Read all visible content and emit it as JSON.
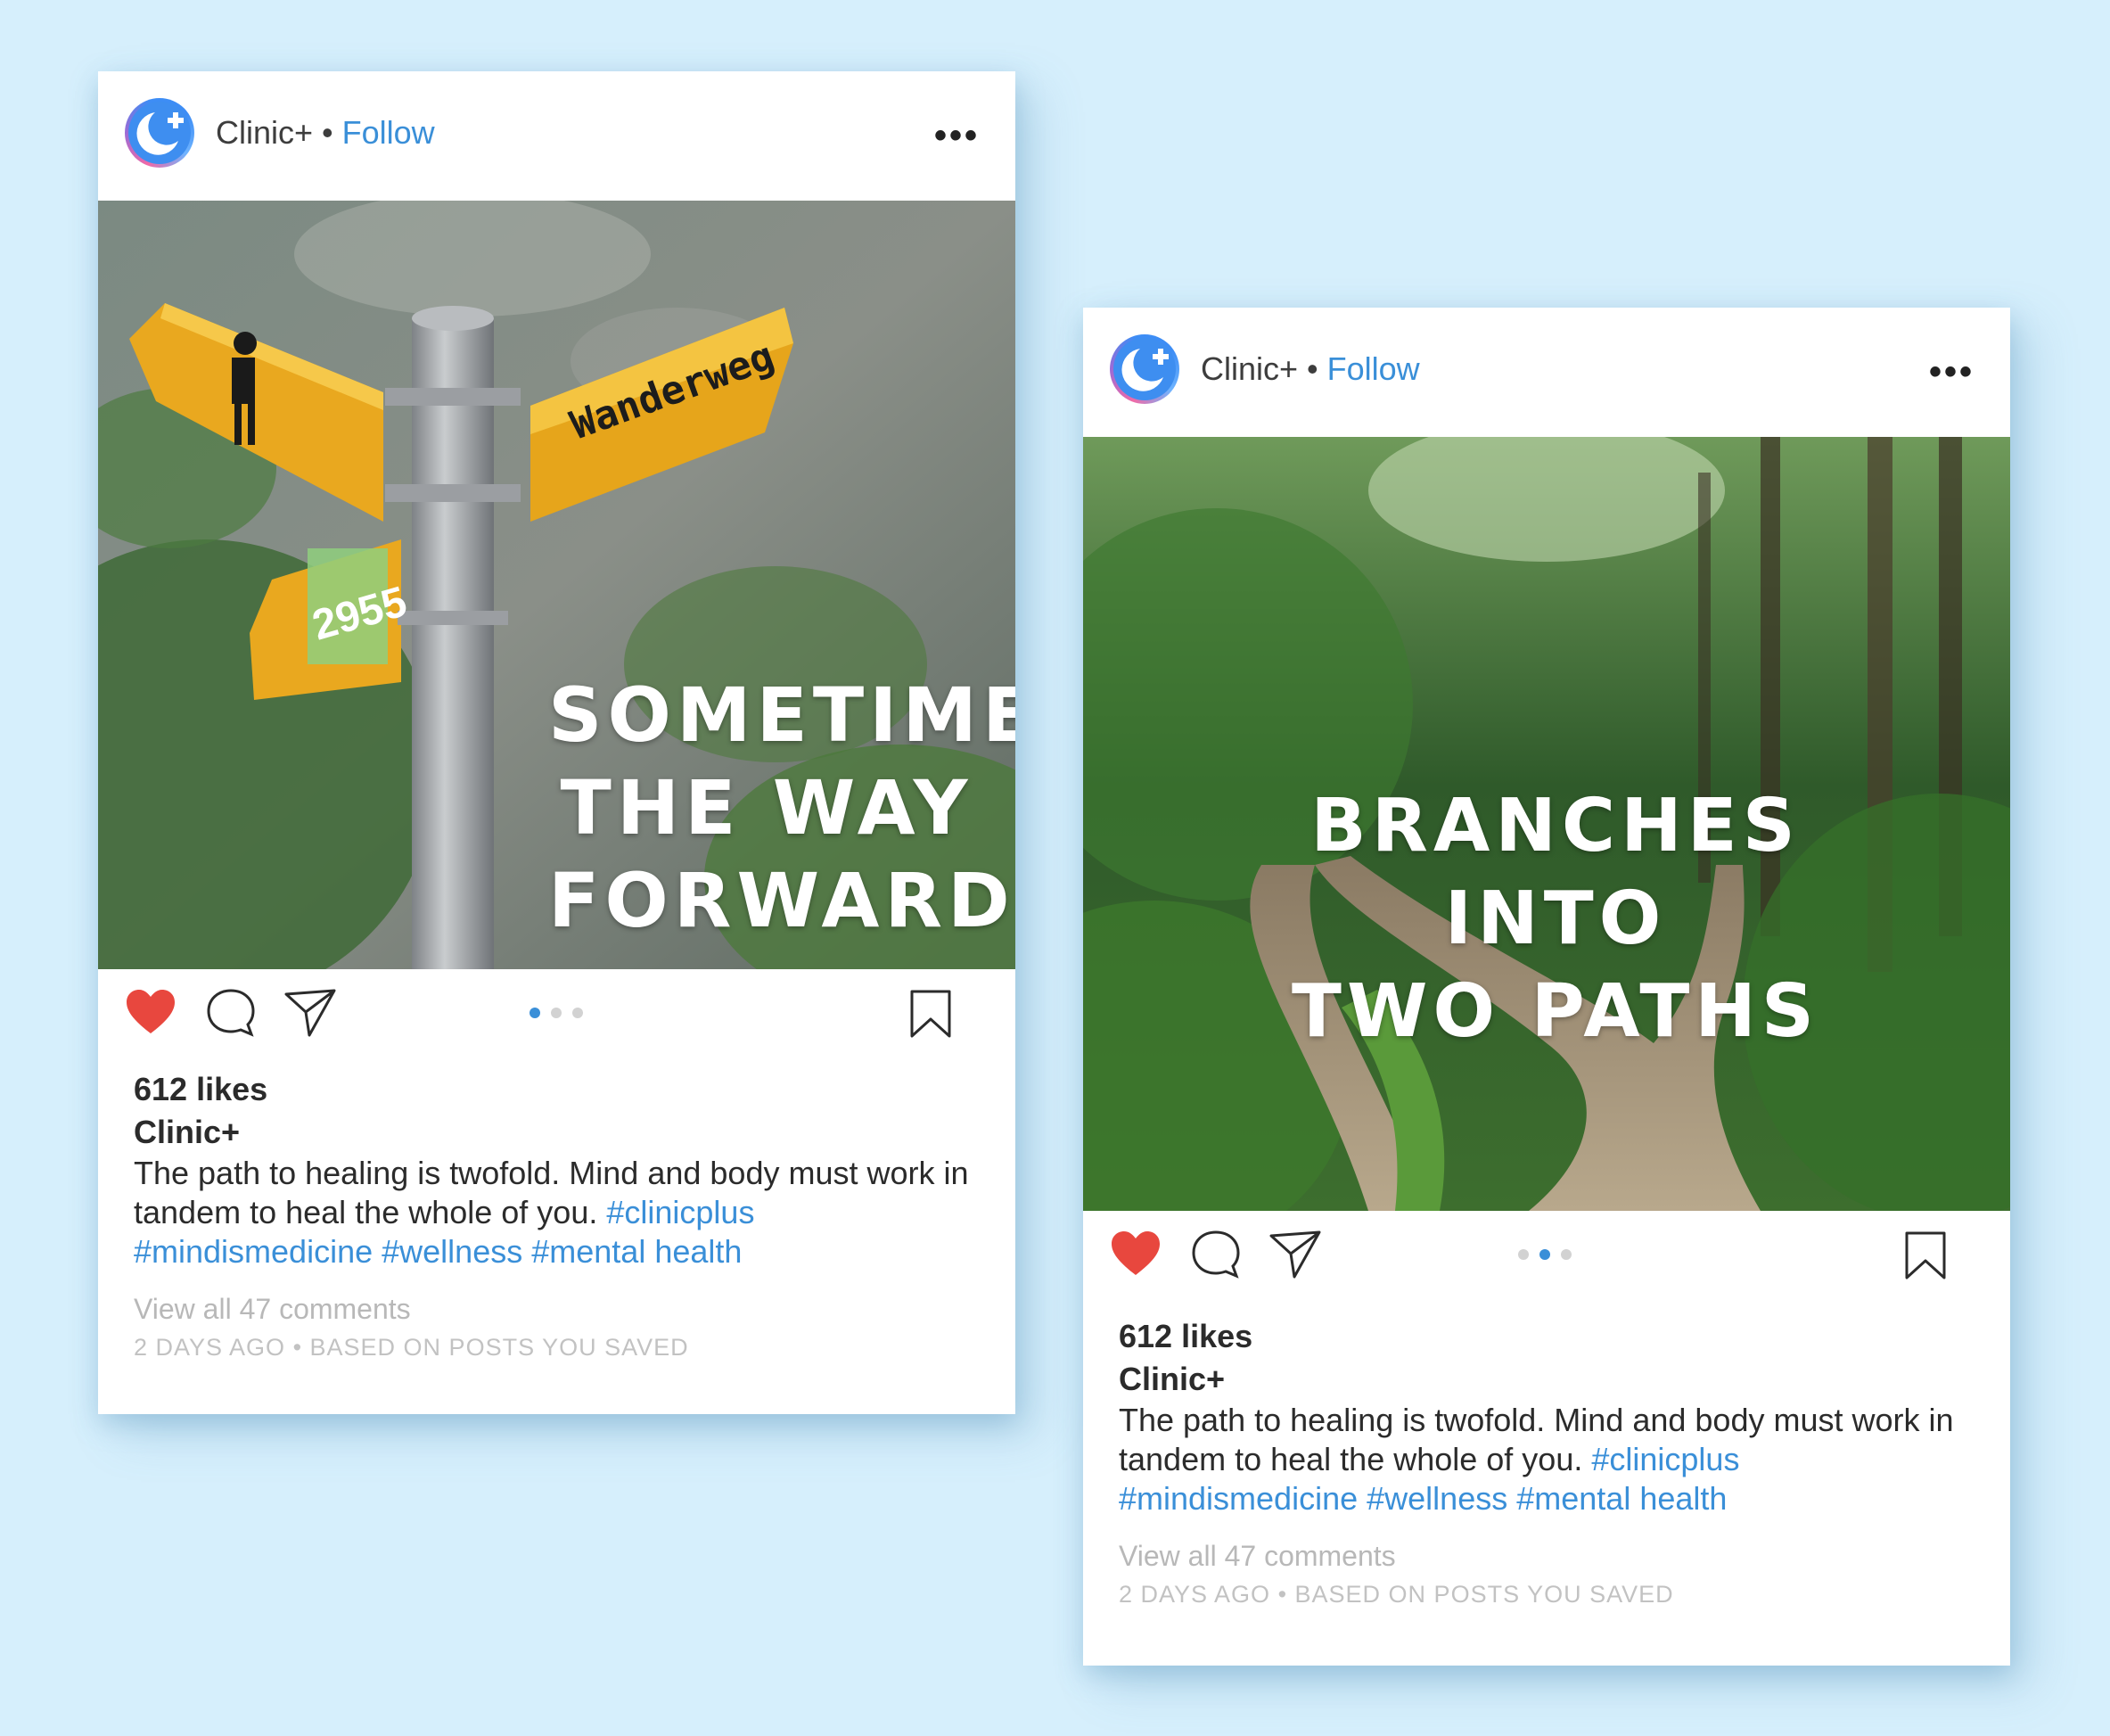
{
  "colors": {
    "background": "#d6effc",
    "accent": "#3a8fd8",
    "heart": "#e8473e"
  },
  "posts": [
    {
      "account": "Clinic+",
      "separator": "•",
      "follow_label": "Follow",
      "more_icon": "more-horizontal-icon",
      "more_label": "•••",
      "image_overlay": [
        "SOMETIMES",
        "THE WAY",
        "FORWARD"
      ],
      "sign_text": "Wanderweg",
      "sign_number": "2955",
      "carousel": {
        "total": 3,
        "active": 1
      },
      "likes": "612 likes",
      "author": "Clinic+",
      "caption_text": "The path to healing is twofold. Mind and body must work in tandem to heal the whole of you.",
      "hashtags": [
        "#clinicplus",
        "#mindismedicine",
        "#wellness",
        "#mental health"
      ],
      "comments_link": "View all 47 comments",
      "meta": "2 DAYS AGO • BASED ON POSTS YOU SAVED"
    },
    {
      "account": "Clinic+",
      "separator": "•",
      "follow_label": "Follow",
      "more_icon": "more-horizontal-icon",
      "more_label": "•••",
      "image_overlay": [
        "BRANCHES INTO",
        "TWO PATHS"
      ],
      "carousel": {
        "total": 3,
        "active": 2
      },
      "likes": "612 likes",
      "author": "Clinic+",
      "caption_text": "The path to healing is twofold. Mind and body must work in tandem to heal the whole of you.",
      "hashtags": [
        "#clinicplus",
        "#mindismedicine",
        "#wellness",
        "#mental health"
      ],
      "comments_link": "View all 47 comments",
      "meta": "2 DAYS AGO • BASED ON POSTS YOU SAVED"
    }
  ]
}
